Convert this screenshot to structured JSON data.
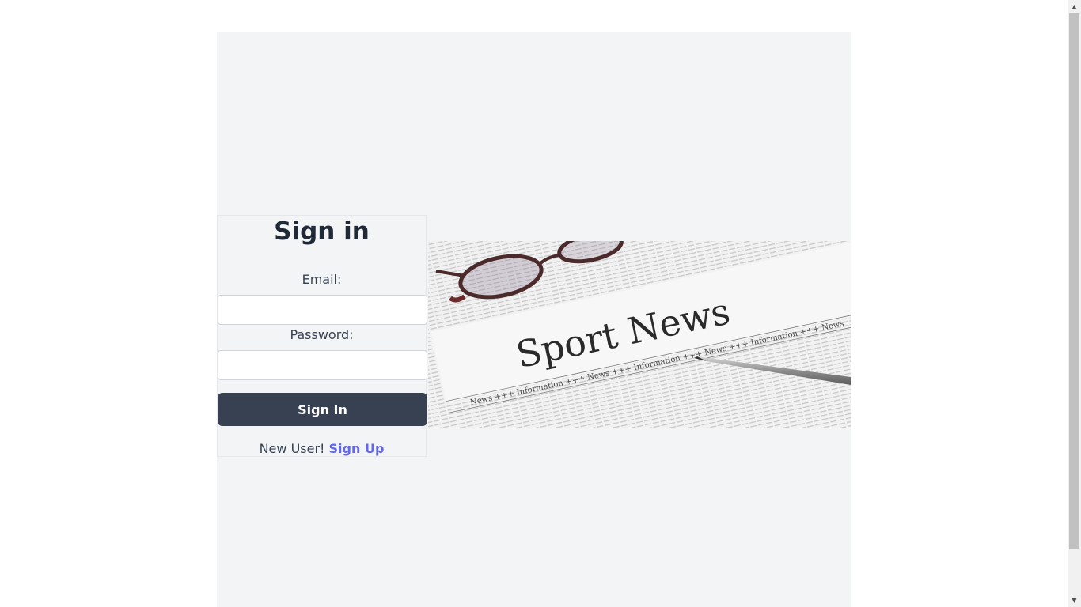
{
  "form": {
    "title": "Sign in",
    "email_label": "Email:",
    "email_value": "",
    "password_label": "Password:",
    "password_value": "",
    "submit_label": "Sign In",
    "new_user_text": "New User! ",
    "signup_link": "Sign Up"
  },
  "banner": {
    "headline": "Sport News",
    "ticker": "News +++ Information +++ News +++ Information +++ News +++ Information +++ News"
  },
  "scrollbar": {
    "up_icon": "▲",
    "down_icon": "▼"
  },
  "colors": {
    "page_bg": "#ffffff",
    "container_bg": "#f3f4f6",
    "button_bg": "#374151",
    "link": "#6366f1"
  }
}
